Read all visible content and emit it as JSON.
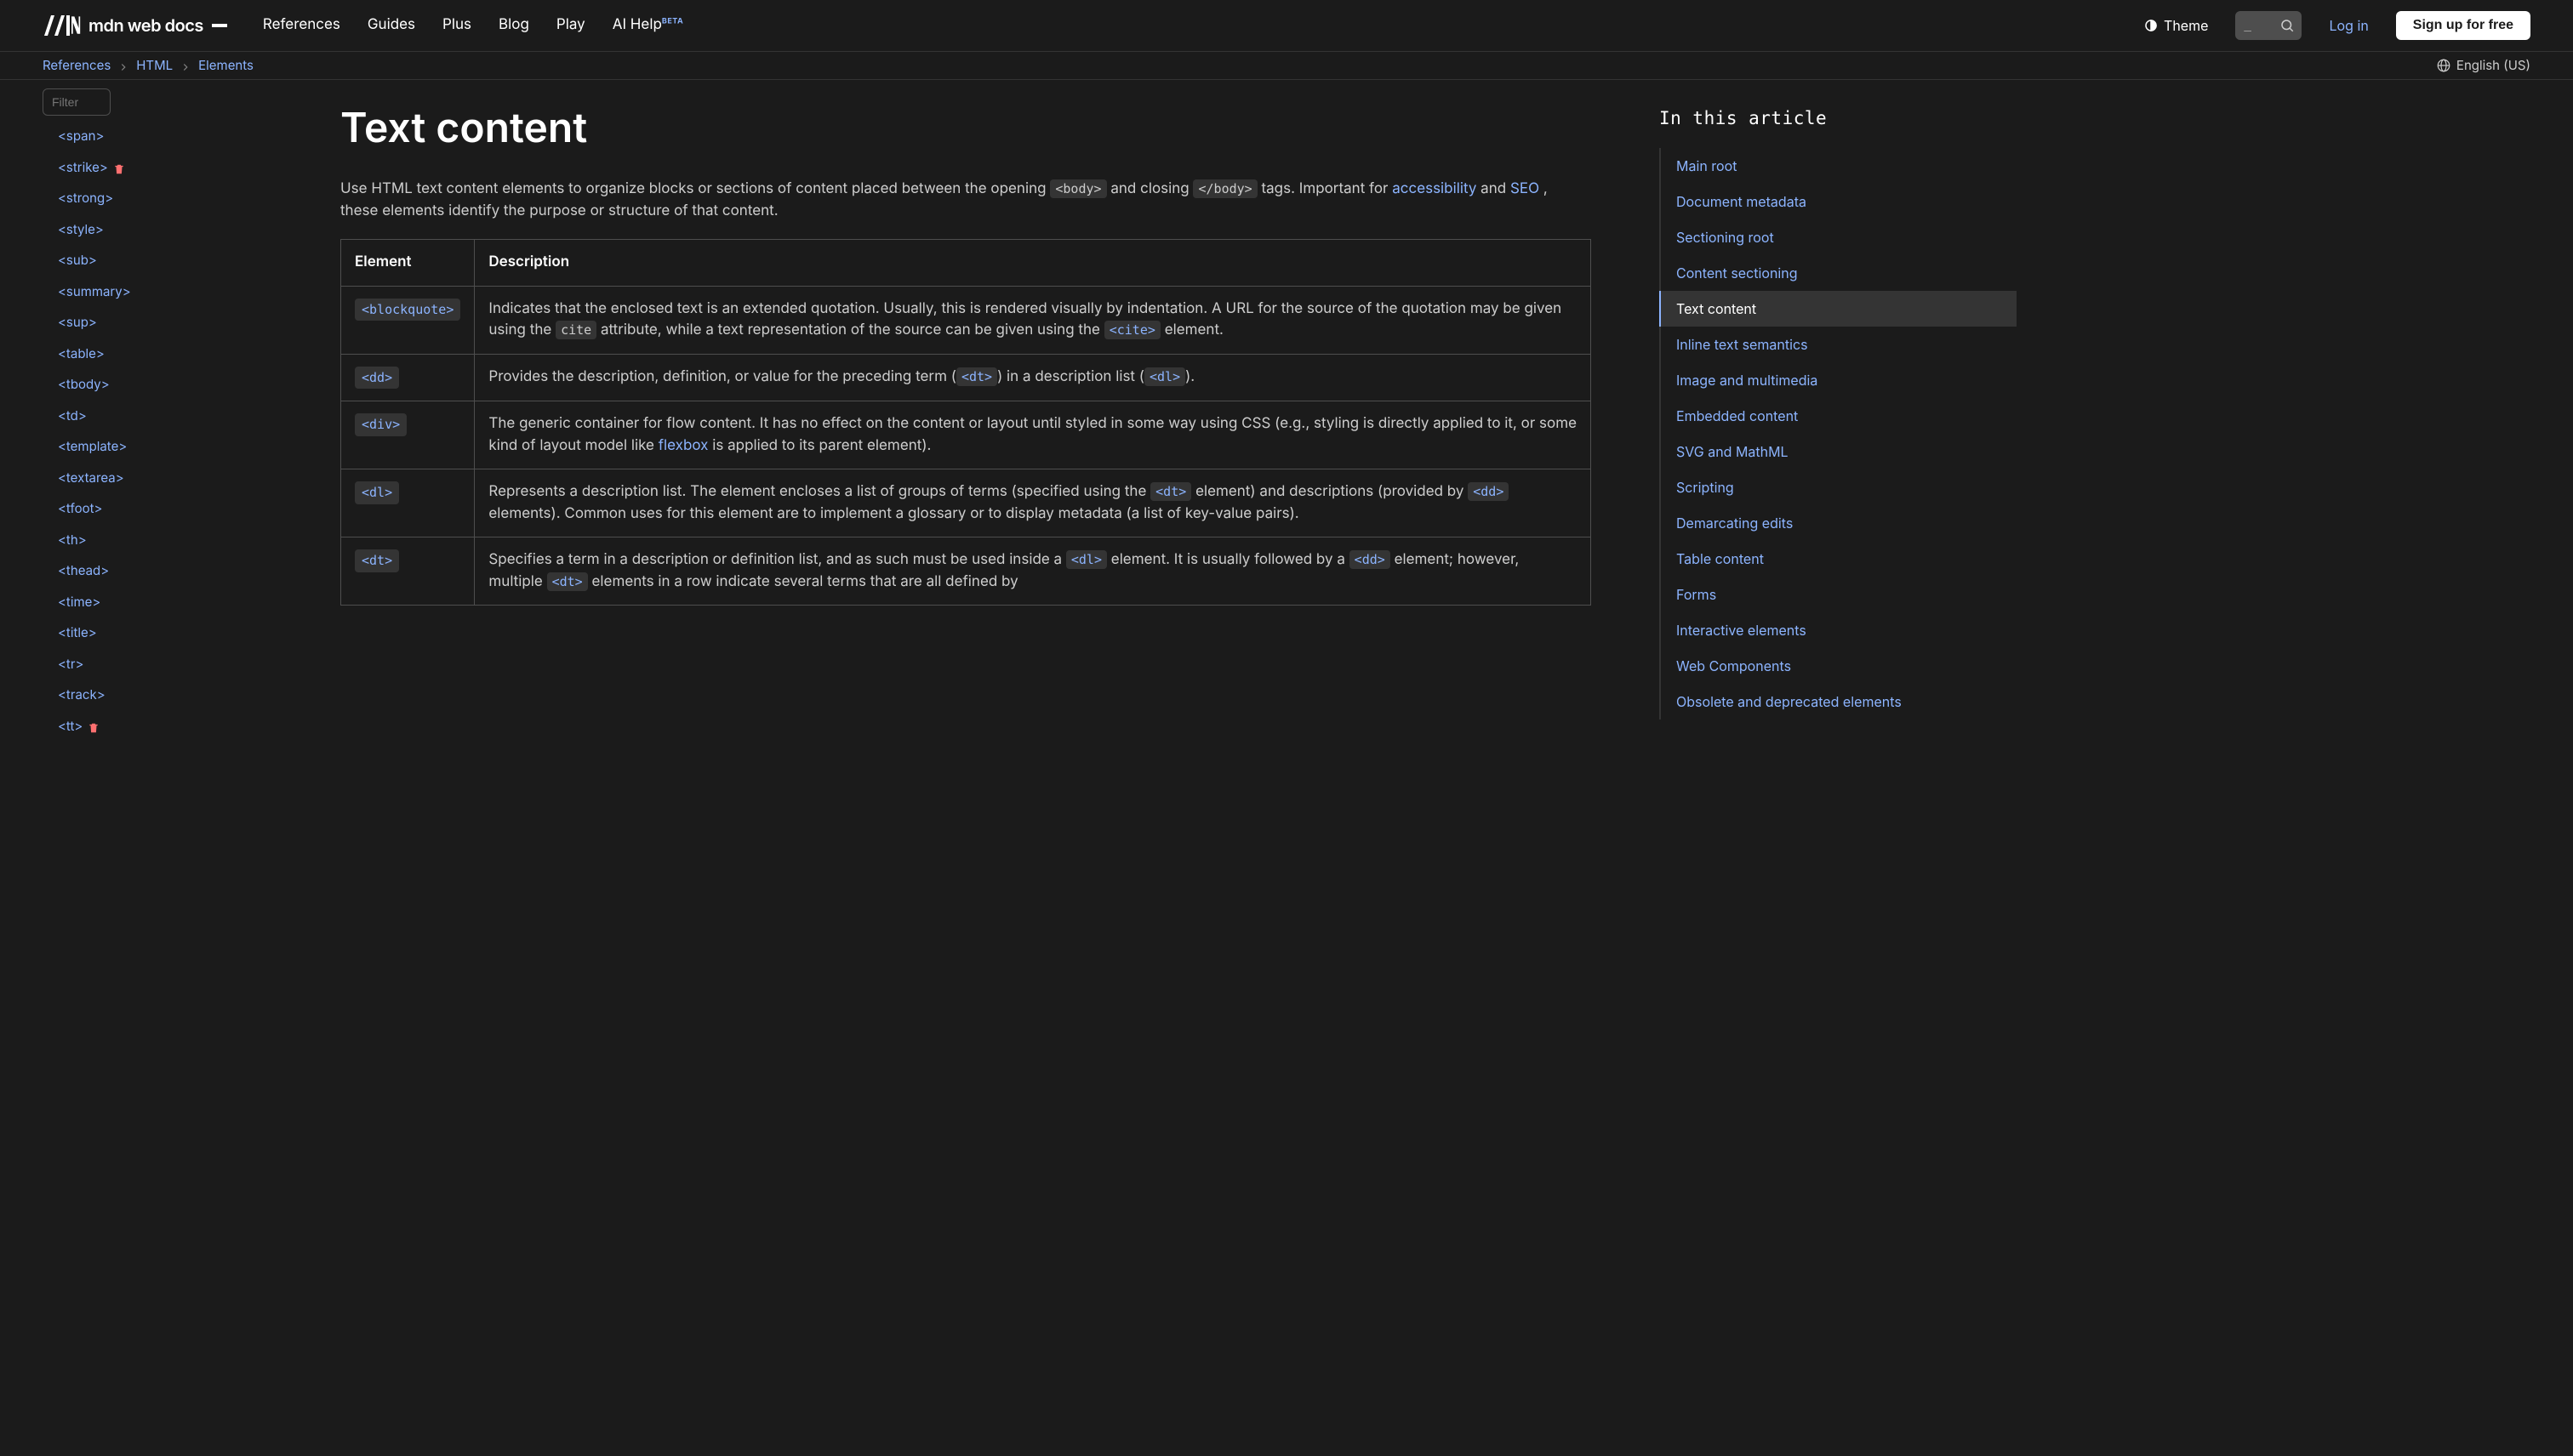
{
  "topbar": {
    "logo_text": "mdn web docs",
    "nav": [
      "References",
      "Guides",
      "Plus",
      "Blog",
      "Play",
      "AI Help"
    ],
    "beta_label": "BETA",
    "theme_label": "Theme",
    "search_placeholder": "_",
    "login_label": "Log in",
    "signup_label": "Sign up for free"
  },
  "crumbs": {
    "items": [
      "References",
      "HTML",
      "Elements"
    ],
    "language": "English (US)"
  },
  "sidebar": {
    "filter_placeholder": "Filter",
    "items": [
      {
        "label": "<span>",
        "deprecated": false
      },
      {
        "label": "<strike>",
        "deprecated": true
      },
      {
        "label": "<strong>",
        "deprecated": false
      },
      {
        "label": "<style>",
        "deprecated": false
      },
      {
        "label": "<sub>",
        "deprecated": false
      },
      {
        "label": "<summary>",
        "deprecated": false
      },
      {
        "label": "<sup>",
        "deprecated": false
      },
      {
        "label": "<table>",
        "deprecated": false
      },
      {
        "label": "<tbody>",
        "deprecated": false
      },
      {
        "label": "<td>",
        "deprecated": false
      },
      {
        "label": "<template>",
        "deprecated": false
      },
      {
        "label": "<textarea>",
        "deprecated": false
      },
      {
        "label": "<tfoot>",
        "deprecated": false
      },
      {
        "label": "<th>",
        "deprecated": false
      },
      {
        "label": "<thead>",
        "deprecated": false
      },
      {
        "label": "<time>",
        "deprecated": false
      },
      {
        "label": "<title>",
        "deprecated": false
      },
      {
        "label": "<tr>",
        "deprecated": false
      },
      {
        "label": "<track>",
        "deprecated": false
      },
      {
        "label": "<tt>",
        "deprecated": true
      }
    ]
  },
  "article": {
    "heading": "Text content",
    "intro_prefix": "Use HTML text content elements to organize blocks or sections of content placed between the opening ",
    "body_tag": "<body>",
    "intro_mid": " and closing ",
    "body_close_tag": "</body>",
    "intro_after": " tags. Important for ",
    "link_accessibility": "accessibility",
    "and_word": " and ",
    "link_seo": "SEO",
    "intro_tail": ", these elements identify the purpose or structure of that content.",
    "th_element": "Element",
    "th_description": "Description",
    "rows": [
      {
        "element": "<blockquote>",
        "desc_parts": [
          "Indicates that the enclosed text is an extended quotation. Usually, this is rendered visually by indentation. A URL for the source of the quotation may be given using the ",
          {
            "code": "cite",
            "plain": true
          },
          " attribute, while a text representation of the source can be given using the ",
          {
            "code": "<cite>"
          },
          " element."
        ]
      },
      {
        "element": "<dd>",
        "desc_parts": [
          "Provides the description, definition, or value for the preceding term (",
          {
            "code": "<dt>"
          },
          ") in a description list (",
          {
            "code": "<dl>"
          },
          ")."
        ]
      },
      {
        "element": "<div>",
        "desc_parts": [
          "The generic container for flow content. It has no effect on the content or layout until styled in some way using CSS (e.g., styling is directly applied to it, or some kind of layout model like ",
          {
            "link": "flexbox"
          },
          " is applied to its parent element)."
        ]
      },
      {
        "element": "<dl>",
        "desc_parts": [
          "Represents a description list. The element encloses a list of groups of terms (specified using the ",
          {
            "code": "<dt>"
          },
          " element) and descriptions (provided by ",
          {
            "code": "<dd>"
          },
          " elements). Common uses for this element are to implement a glossary or to display metadata (a list of key-value pairs)."
        ]
      },
      {
        "element": "<dt>",
        "desc_parts": [
          "Specifies a term in a description or definition list, and as such must be used inside a ",
          {
            "code": "<dl>"
          },
          " element. It is usually followed by a ",
          {
            "code": "<dd>"
          },
          " element; however, multiple ",
          {
            "code": "<dt>"
          },
          " elements in a row indicate several terms that are all defined by"
        ]
      }
    ]
  },
  "toc": {
    "title": "In this article",
    "items": [
      "Main root",
      "Document metadata",
      "Sectioning root",
      "Content sectioning",
      "Text content",
      "Inline text semantics",
      "Image and multimedia",
      "Embedded content",
      "SVG and MathML",
      "Scripting",
      "Demarcating edits",
      "Table content",
      "Forms",
      "Interactive elements",
      "Web Components",
      "Obsolete and deprecated elements"
    ],
    "active_index": 4
  }
}
